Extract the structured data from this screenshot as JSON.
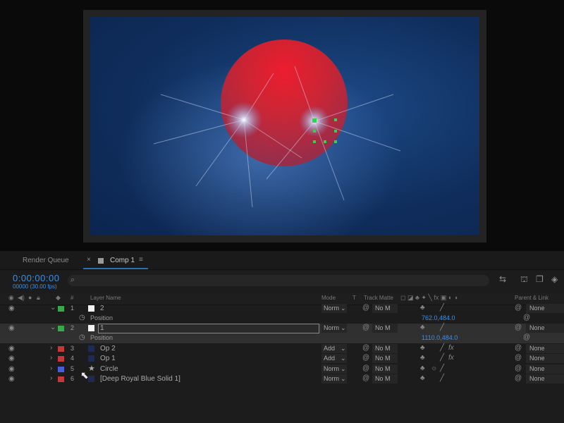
{
  "tabs": [
    {
      "label": "Render Queue"
    },
    {
      "label": "Comp 1"
    }
  ],
  "tab_close_glyph": "×",
  "tab_menu_glyph": "≡",
  "timecode": "0:00:00:00",
  "frame_info": "00000 (30.00 fps)",
  "columns": {
    "layer_name": "Layer Name",
    "mode": "Mode",
    "t": "T",
    "track_matte": "Track Matte",
    "parent": "Parent & Link"
  },
  "layers": [
    {
      "num": "1",
      "name": "2",
      "mode": "Norm",
      "matte": "No M",
      "parent": "None",
      "label_color": "#3aa74a",
      "expanded": true,
      "property": {
        "name": "Position",
        "value": "762.0,484.0"
      }
    },
    {
      "num": "2",
      "name": "1",
      "mode": "Norm",
      "matte": "No M",
      "parent": "None",
      "label_color": "#3aa74a",
      "expanded": true,
      "selected": true,
      "property": {
        "name": "Position",
        "value": "1110.0,484.0"
      }
    },
    {
      "num": "3",
      "name": "Op 2",
      "mode": "Add",
      "matte": "No M",
      "parent": "None",
      "label_color": "#c03a3a",
      "fx": true
    },
    {
      "num": "4",
      "name": "Op 1",
      "mode": "Add",
      "matte": "No M",
      "parent": "None",
      "label_color": "#c03a3a",
      "fx": true
    },
    {
      "num": "5",
      "name": "Circle",
      "mode": "Norm",
      "matte": "No M",
      "parent": "None",
      "label_color": "#4a5ed8",
      "shape_layer": true
    },
    {
      "num": "6",
      "name": "[Deep Royal Blue Solid 1]",
      "mode": "Norm",
      "matte": "No M",
      "parent": "None",
      "label_color": "#c03a3a"
    }
  ],
  "colors": {
    "accent": "#3f8fe0",
    "circle": "#e8202a",
    "background_blue": "#163c72"
  },
  "icons": [
    "search-icon",
    "eye-icon",
    "audio-icon",
    "solo-icon",
    "lock-icon",
    "label-icon",
    "stopwatch-icon",
    "spiral-icon",
    "star-icon",
    "fx-icon",
    "cursor-icon"
  ]
}
